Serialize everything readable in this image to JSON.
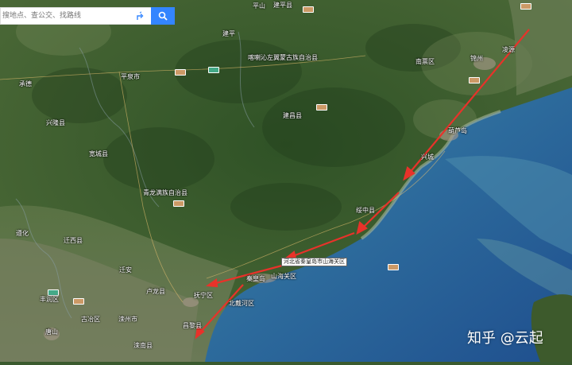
{
  "search": {
    "placeholder": "搜地点、查公交、找路线"
  },
  "callout": {
    "text": "河北省秦皇岛市山海关区"
  },
  "watermark": "知乎 @云起",
  "labels": {
    "lingyuan_n": "建平县",
    "chengde_county": "承德",
    "pingquan": "平泉市",
    "kazuo": "喀喇沁左翼蒙古族自治县",
    "jianchang": "建昌县",
    "xinglong": "兴隆县",
    "kuancheng": "宽城县",
    "qinglong": "青龙满族自治县",
    "nanpiao": "南票区",
    "jinzhou": "锦州",
    "huludao": "葫芦岛",
    "xingcheng": "兴城",
    "suizhong": "绥中县",
    "qianxi": "迁西县",
    "zunhua": "遵化",
    "qian_an": "迁安",
    "lulong": "卢龙县",
    "funing": "抚宁区",
    "qinhuangdao": "秦皇岛",
    "shanhaiguan": "山海关区",
    "beidaihe": "北戴河区",
    "changli": "昌黎县",
    "tangshan": "唐山",
    "fengrun": "丰润区",
    "guye": "古冶区",
    "luanzhou": "滦州市",
    "luannan": "滦南县",
    "jianping": "建平",
    "lingyuan": "凌源",
    "pingshan": "平山"
  },
  "colors": {
    "arrow": "#e8322a",
    "search_button": "#3385ff"
  }
}
